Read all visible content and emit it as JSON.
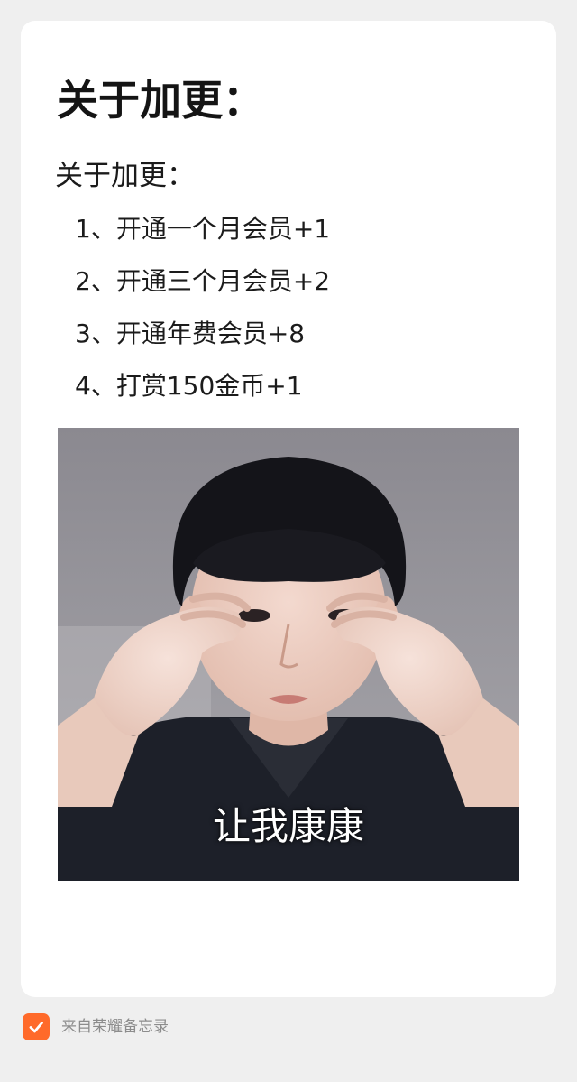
{
  "note": {
    "title": "关于加更：",
    "subtitle": "关于加更：",
    "items": [
      "1、开通一个月会员+1",
      "2、开通三个月会员+2",
      "3、开通年费会员+8",
      "4、打赏150金币+1"
    ],
    "image": {
      "caption": "让我康康"
    }
  },
  "footer": {
    "source_text": "来自荣耀备忘录",
    "icon": "checkmark-icon",
    "accent_color": "#ff6a2a"
  }
}
